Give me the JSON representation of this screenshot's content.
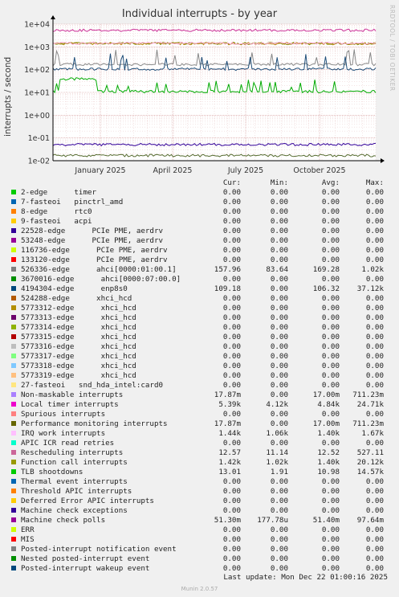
{
  "title": "Individual interrupts - by year",
  "side_text": "RRDTOOL / TOBI OETIKER",
  "footer": "Last update: Mon Dec 22 01:00:16 2025",
  "version": "Munin 2.0.57",
  "columns": [
    "Cur:",
    "Min:",
    "Avg:",
    "Max:"
  ],
  "chart_data": {
    "type": "line",
    "ylabel": "interrupts / second",
    "yscale": "log",
    "ylim": [
      0.01,
      10000
    ],
    "yticks": [
      "1e-02",
      "1e-01",
      "1e+00",
      "1e+01",
      "1e+02",
      "1e+03",
      "1e+04"
    ],
    "xticks": [
      "January 2025",
      "April 2025",
      "July 2025",
      "October 2025"
    ],
    "grid": true,
    "series": [
      {
        "name": "Local timer interrupts",
        "color": "#cc3399",
        "level": 5390
      },
      {
        "name": "Rescheduling interrupts",
        "color": "#b8860b",
        "level": 1400
      },
      {
        "name": "Function call interrupts",
        "color": "#888800",
        "level": 1420
      },
      {
        "name": "IRQ work interrupts",
        "color": "#ffaadd",
        "level": 1440
      },
      {
        "name": "ahci[0000:01:00.1]",
        "color": "#888888",
        "level": 169
      },
      {
        "name": "enp8s0",
        "color": "#1f4e79",
        "level": 106
      },
      {
        "name": "TLB shootdowns",
        "color": "#00aa00",
        "level": 11
      },
      {
        "name": "Machine check polls",
        "color": "#330099",
        "level": 0.0514
      },
      {
        "name": "Non-maskable interrupts",
        "color": "#556b2f",
        "level": 0.017
      }
    ]
  },
  "legend": [
    {
      "name": "2-edge      timer",
      "color": "#00cc00",
      "cur": "0.00",
      "min": "0.00",
      "avg": "0.00",
      "max": "0.00"
    },
    {
      "name": "7-fasteoi   pinctrl_amd",
      "color": "#0066b3",
      "cur": "0.00",
      "min": "0.00",
      "avg": "0.00",
      "max": "0.00"
    },
    {
      "name": "8-edge      rtc0",
      "color": "#ff8000",
      "cur": "0.00",
      "min": "0.00",
      "avg": "0.00",
      "max": "0.00"
    },
    {
      "name": "9-fasteoi   acpi",
      "color": "#ffcc00",
      "cur": "0.00",
      "min": "0.00",
      "avg": "0.00",
      "max": "0.00"
    },
    {
      "name": "22528-edge      PCIe PME, aerdrv",
      "color": "#330099",
      "cur": "0.00",
      "min": "0.00",
      "avg": "0.00",
      "max": "0.00"
    },
    {
      "name": "53248-edge      PCIe PME, aerdrv",
      "color": "#990099",
      "cur": "0.00",
      "min": "0.00",
      "avg": "0.00",
      "max": "0.00"
    },
    {
      "name": "116736-edge      PCIe PME, aerdrv",
      "color": "#ccff00",
      "cur": "0.00",
      "min": "0.00",
      "avg": "0.00",
      "max": "0.00"
    },
    {
      "name": "133120-edge      PCIe PME, aerdrv",
      "color": "#ff0000",
      "cur": "0.00",
      "min": "0.00",
      "avg": "0.00",
      "max": "0.00"
    },
    {
      "name": "526336-edge      ahci[0000:01:00.1]",
      "color": "#808080",
      "cur": "157.96",
      "min": "83.64",
      "avg": "169.28",
      "max": "1.02k"
    },
    {
      "name": "3670016-edge      ahci[0000:07:00.0]",
      "color": "#008f00",
      "cur": "0.00",
      "min": "0.00",
      "avg": "0.00",
      "max": "0.00"
    },
    {
      "name": "4194304-edge      enp8s0",
      "color": "#00487d",
      "cur": "109.18",
      "min": "0.00",
      "avg": "106.32",
      "max": "37.12k"
    },
    {
      "name": "524288-edge      xhci_hcd",
      "color": "#b35a00",
      "cur": "0.00",
      "min": "0.00",
      "avg": "0.00",
      "max": "0.00"
    },
    {
      "name": "5773312-edge      xhci_hcd",
      "color": "#b38f00",
      "cur": "0.00",
      "min": "0.00",
      "avg": "0.00",
      "max": "0.00"
    },
    {
      "name": "5773313-edge      xhci_hcd",
      "color": "#6b006b",
      "cur": "0.00",
      "min": "0.00",
      "avg": "0.00",
      "max": "0.00"
    },
    {
      "name": "5773314-edge      xhci_hcd",
      "color": "#8fb300",
      "cur": "0.00",
      "min": "0.00",
      "avg": "0.00",
      "max": "0.00"
    },
    {
      "name": "5773315-edge      xhci_hcd",
      "color": "#b30000",
      "cur": "0.00",
      "min": "0.00",
      "avg": "0.00",
      "max": "0.00"
    },
    {
      "name": "5773316-edge      xhci_hcd",
      "color": "#bebebe",
      "cur": "0.00",
      "min": "0.00",
      "avg": "0.00",
      "max": "0.00"
    },
    {
      "name": "5773317-edge      xhci_hcd",
      "color": "#80ff80",
      "cur": "0.00",
      "min": "0.00",
      "avg": "0.00",
      "max": "0.00"
    },
    {
      "name": "5773318-edge      xhci_hcd",
      "color": "#80c9ff",
      "cur": "0.00",
      "min": "0.00",
      "avg": "0.00",
      "max": "0.00"
    },
    {
      "name": "5773319-edge      xhci_hcd",
      "color": "#ffc080",
      "cur": "0.00",
      "min": "0.00",
      "avg": "0.00",
      "max": "0.00"
    },
    {
      "name": "27-fasteoi   snd_hda_intel:card0",
      "color": "#ffe680",
      "cur": "0.00",
      "min": "0.00",
      "avg": "0.00",
      "max": "0.00"
    },
    {
      "name": "Non-maskable interrupts",
      "color": "#aa80ff",
      "cur": "17.87m",
      "min": "0.00",
      "avg": "17.00m",
      "max": "711.23m"
    },
    {
      "name": "Local timer interrupts",
      "color": "#ee00cc",
      "cur": "5.39k",
      "min": "4.12k",
      "avg": "4.84k",
      "max": "24.71k"
    },
    {
      "name": "Spurious interrupts",
      "color": "#ff8080",
      "cur": "0.00",
      "min": "0.00",
      "avg": "0.00",
      "max": "0.00"
    },
    {
      "name": "Performance monitoring interrupts",
      "color": "#666600",
      "cur": "17.87m",
      "min": "0.00",
      "avg": "17.00m",
      "max": "711.23m"
    },
    {
      "name": "IRQ work interrupts",
      "color": "#ffbfff",
      "cur": "1.44k",
      "min": "1.06k",
      "avg": "1.40k",
      "max": "1.67k"
    },
    {
      "name": "APIC ICR read retries",
      "color": "#00ffcc",
      "cur": "0.00",
      "min": "0.00",
      "avg": "0.00",
      "max": "0.00"
    },
    {
      "name": "Rescheduling interrupts",
      "color": "#cc6699",
      "cur": "12.57",
      "min": "11.14",
      "avg": "12.52",
      "max": "527.11"
    },
    {
      "name": "Function call interrupts",
      "color": "#999900",
      "cur": "1.42k",
      "min": "1.02k",
      "avg": "1.40k",
      "max": "20.12k"
    },
    {
      "name": "TLB shootdowns",
      "color": "#00cc00",
      "cur": "13.01",
      "min": "1.91",
      "avg": "10.98",
      "max": "14.57k"
    },
    {
      "name": "Thermal event interrupts",
      "color": "#0066b3",
      "cur": "0.00",
      "min": "0.00",
      "avg": "0.00",
      "max": "0.00"
    },
    {
      "name": "Threshold APIC interrupts",
      "color": "#ff8000",
      "cur": "0.00",
      "min": "0.00",
      "avg": "0.00",
      "max": "0.00"
    },
    {
      "name": "Deferred Error APIC interrupts",
      "color": "#ffcc00",
      "cur": "0.00",
      "min": "0.00",
      "avg": "0.00",
      "max": "0.00"
    },
    {
      "name": "Machine check exceptions",
      "color": "#330099",
      "cur": "0.00",
      "min": "0.00",
      "avg": "0.00",
      "max": "0.00"
    },
    {
      "name": "Machine check polls",
      "color": "#990099",
      "cur": "51.30m",
      "min": "177.78u",
      "avg": "51.40m",
      "max": "97.64m"
    },
    {
      "name": "ERR",
      "color": "#ccff00",
      "cur": "0.00",
      "min": "0.00",
      "avg": "0.00",
      "max": "0.00"
    },
    {
      "name": "MIS",
      "color": "#ff0000",
      "cur": "0.00",
      "min": "0.00",
      "avg": "0.00",
      "max": "0.00"
    },
    {
      "name": "Posted-interrupt notification event",
      "color": "#808080",
      "cur": "0.00",
      "min": "0.00",
      "avg": "0.00",
      "max": "0.00"
    },
    {
      "name": "Nested posted-interrupt event",
      "color": "#008f00",
      "cur": "0.00",
      "min": "0.00",
      "avg": "0.00",
      "max": "0.00"
    },
    {
      "name": "Posted-interrupt wakeup event",
      "color": "#00487d",
      "cur": "0.00",
      "min": "0.00",
      "avg": "0.00",
      "max": "0.00"
    }
  ]
}
